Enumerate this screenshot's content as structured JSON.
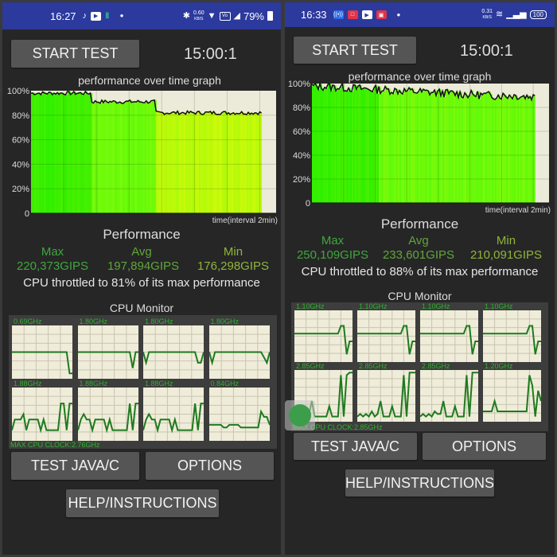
{
  "screens": [
    {
      "id": "left",
      "status_bar": {
        "time": "16:27",
        "icons": [
          "tiktok-icon",
          "youtube-icon",
          "battery-saver-icon",
          "dot-icon"
        ],
        "right_icons": [
          "bluetooth-icon",
          "wifi-icon",
          "volte-wifi-icon",
          "signal-icon"
        ],
        "net_speed": "0.60",
        "net_unit": "KB/S",
        "battery_text": "79%"
      },
      "start_button": "START TEST",
      "timer": "15:00:1",
      "graph": {
        "title": "performance over time graph",
        "xlabel": "time(interval 2min)",
        "yticks": [
          "0",
          "20%",
          "40%",
          "60%",
          "80%",
          "100%"
        ]
      },
      "performance": {
        "title": "Performance",
        "max_label": "Max",
        "avg_label": "Avg",
        "min_label": "Min",
        "max_value": "220,373GIPS",
        "avg_value": "197,894GIPS",
        "min_value": "176,298GIPS",
        "throttle_text": "CPU throttled to 81% of its max performance"
      },
      "cpu_monitor": {
        "title": "CPU Monitor",
        "cores": [
          "0.69GHz",
          "1.80GHz",
          "1.80GHz",
          "1.80GHz",
          "1.88GHz",
          "1.88GHz",
          "1.88GHz",
          "0.84GHz"
        ],
        "max_clock": "MAX CPU CLOCK:2.76GHz"
      },
      "buttons": {
        "test_java": "TEST JAVA/C",
        "options": "OPTIONS",
        "help": "HELP/INSTRUCTIONS"
      }
    },
    {
      "id": "right",
      "status_bar": {
        "time": "16:33",
        "icons": [
          "broadcast-icon",
          "app-red-icon",
          "youtube-icon",
          "app-red-icon",
          "dot-icon"
        ],
        "right_icons": [
          "wifi-icon",
          "signal-icon"
        ],
        "net_speed": "0.31",
        "net_unit": "KB/S",
        "battery_text": "100"
      },
      "start_button": "START TEST",
      "timer": "15:00:1",
      "graph": {
        "title": "performance over time graph",
        "xlabel": "time(interval 2min)",
        "yticks": [
          "0",
          "20%",
          "40%",
          "60%",
          "80%",
          "100%"
        ]
      },
      "performance": {
        "title": "Performance",
        "max_label": "Max",
        "avg_label": "Avg",
        "min_label": "Min",
        "max_value": "250,109GIPS",
        "avg_value": "233,601GIPS",
        "min_value": "210,091GIPS",
        "throttle_text": "CPU throttled to 88% of its max performance"
      },
      "cpu_monitor": {
        "title": "CPU Monitor",
        "cores": [
          "1.10GHz",
          "1.10GHz",
          "1.10GHz",
          "1.10GHz",
          "2.85GHz",
          "2.85GHz",
          "2.85GHz",
          "1.20GHz"
        ],
        "max_clock": "MAX CPU CLOCK:2.85GHz"
      },
      "buttons": {
        "test_java": "TEST JAVA/C",
        "options": "OPTIONS",
        "help": "HELP/INSTRUCTIONS"
      }
    }
  ],
  "chart_data": [
    {
      "type": "area",
      "title": "performance over time graph",
      "xlabel": "time(interval 2min)",
      "ylabel": "",
      "ylim": [
        0,
        100
      ],
      "yticks": [
        "0",
        "20%",
        "40%",
        "60%",
        "80%",
        "100%"
      ],
      "grid": true,
      "x_fraction_filled": 0.94,
      "segments_percent": [
        {
          "from": 0.0,
          "to": 0.26,
          "level": 98
        },
        {
          "from": 0.26,
          "to": 0.54,
          "level": 91
        },
        {
          "from": 0.54,
          "to": 0.94,
          "level": 82
        }
      ],
      "throttled_to_percent": 81
    },
    {
      "type": "area",
      "title": "performance over time graph",
      "xlabel": "time(interval 2min)",
      "ylabel": "",
      "ylim": [
        0,
        100
      ],
      "yticks": [
        "0",
        "20%",
        "40%",
        "60%",
        "80%",
        "100%"
      ],
      "grid": true,
      "x_fraction_filled": 0.94,
      "trend_percent": [
        98,
        97,
        96,
        95,
        94,
        93,
        92,
        91,
        90,
        90,
        89
      ],
      "throttled_to_percent": 88
    }
  ],
  "colors": {
    "status_bar": "#2c3a9e",
    "background": "#262626",
    "button": "#555555",
    "green_text": "#3fa63f",
    "olive_text": "#8fb53a",
    "core_line": "#1e7a1e",
    "core_bg": "#efecd9"
  }
}
